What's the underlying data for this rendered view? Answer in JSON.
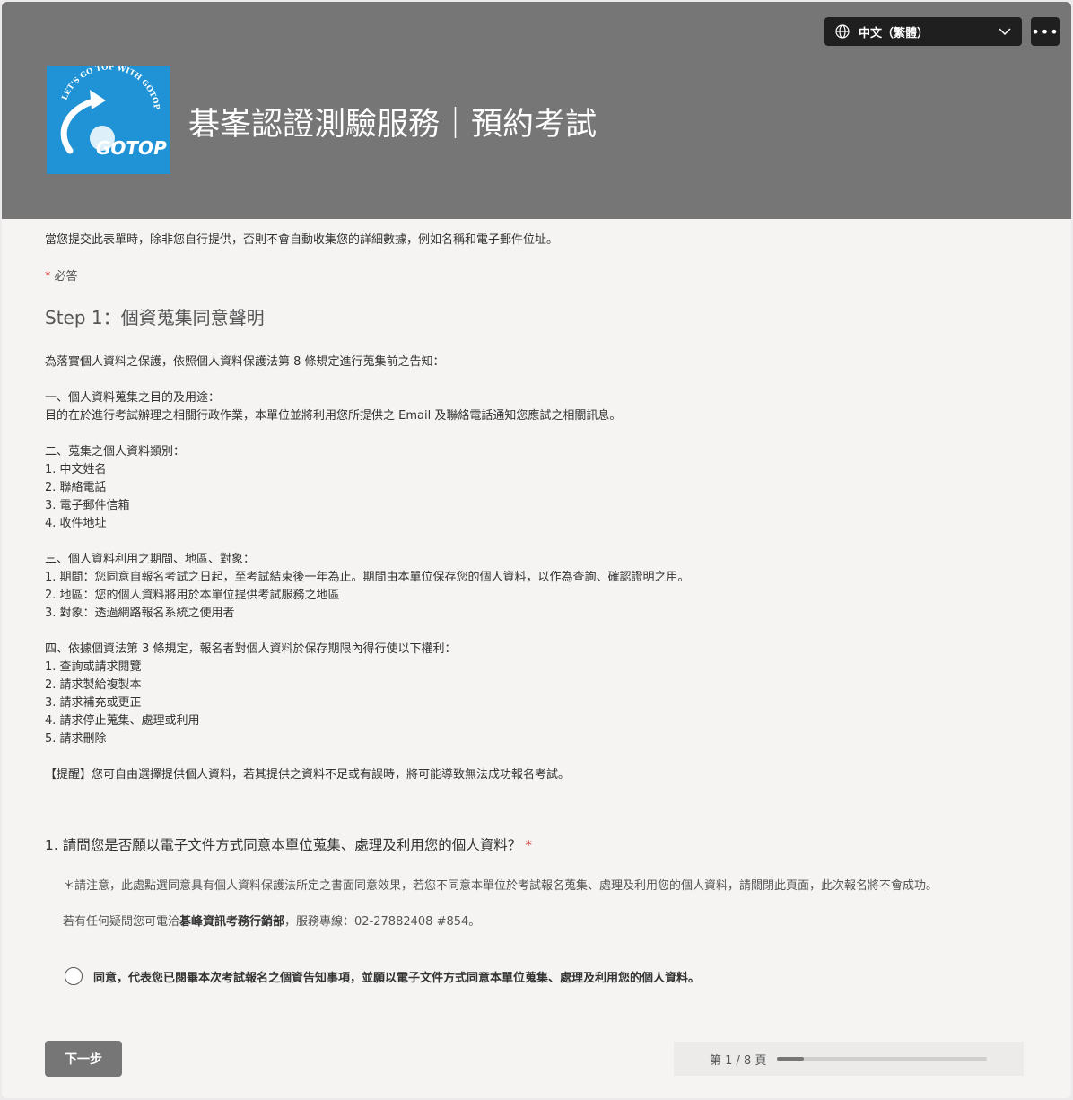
{
  "header": {
    "language": "中文（繁體）",
    "title": "碁峯認證測驗服務｜預約考試",
    "logo": {
      "top_text": "LET'S GO TOP WITH GOTOP",
      "brand": "GOTOP"
    }
  },
  "privacy_notice": "當您提交此表單時，除非您自行提供，否則不會自動收集您的詳細數據，例如名稱和電子郵件位址。",
  "required_label": "必答",
  "section_title": "Step 1：個資蒐集同意聲明",
  "notice_text": "為落實個人資料之保護，依照個人資料保護法第 8 條規定進行蒐集前之告知：\n\n一、個人資料蒐集之目的及用途：\n目的在於進行考試辦理之相關行政作業，本單位並將利用您所提供之 Email 及聯絡電話通知您應試之相關訊息。\n\n二、蒐集之個人資料類別：\n1. 中文姓名\n2. 聯絡電話\n3. 電子郵件信箱\n4. 收件地址\n\n三、個人資料利用之期間、地區、對象：\n1. 期間：您同意自報名考試之日起，至考試結束後一年為止。期間由本單位保存您的個人資料，以作為查詢、確認證明之用。\n2. 地區：您的個人資料將用於本單位提供考試服務之地區\n3. 對象：透過網路報名系統之使用者\n\n四、依據個資法第 3 條規定，報名者對個人資料於保存期限內得行使以下權利：\n1. 查詢或請求閱覽\n2. 請求製給複製本\n3. 請求補充或更正\n4. 請求停止蒐集、處理或利用\n5. 請求刪除\n\n【提醒】您可自由選擇提供個人資料，若其提供之資料不足或有誤時，將可能導致無法成功報名考試。",
  "question": {
    "title": "1. 請問您是否願以電子文件方式同意本單位蒐集、處理及利用您的個人資料？",
    "desc1": "＊請注意，此處點選同意具有個人資料保護法所定之書面同意效果，若您不同意本單位於考試報名蒐集、處理及利用您的個人資料，請關閉此頁面，此次報名將不會成功。",
    "desc2_prefix": "若有任何疑問您可電洽",
    "desc2_bold": "碁峰資訊考務行銷部",
    "desc2_suffix": "，服務專線：02-27882408 #854。",
    "option_label": "同意，代表您已閱畢本次考試報名之個資告知事項，並願以電子文件方式同意本單位蒐集、處理及利用您的個人資料。"
  },
  "footer": {
    "next_label": "下一步",
    "page_indicator": "第 1 / 8 頁",
    "progress": 0.125
  }
}
